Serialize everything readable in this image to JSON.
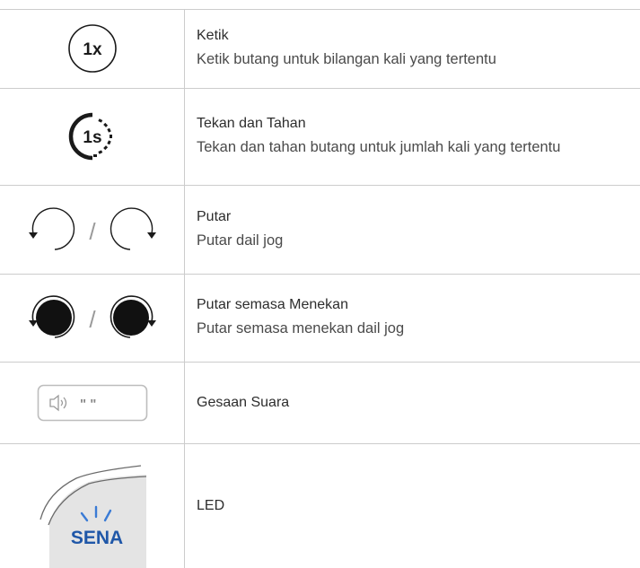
{
  "rows": [
    {
      "icon": "tap-1x-icon",
      "icon_label": "1x",
      "title": "Ketik",
      "description": "Ketik butang untuk bilangan kali yang tertentu"
    },
    {
      "icon": "press-hold-1s-icon",
      "icon_label": "1s",
      "title": "Tekan dan Tahan",
      "description": "Tekan dan tahan butang untuk jumlah kali yang tertentu"
    },
    {
      "icon": "rotate-jog-dial-icon",
      "icon_label": "/",
      "title": "Putar",
      "description": "Putar dail jog"
    },
    {
      "icon": "rotate-while-pressing-icon",
      "icon_label": "/",
      "title": "Putar semasa Menekan",
      "description": "Putar semasa menekan dail jog"
    },
    {
      "icon": "voice-prompt-icon",
      "icon_label": "\" \"",
      "title": "Gesaan Suara",
      "description": ""
    },
    {
      "icon": "led-icon",
      "icon_label": "SENA",
      "title": "LED",
      "description": ""
    }
  ],
  "colors": {
    "rule": "#cccccc",
    "icon_dark": "#1a1a1a",
    "led_blue": "#1f57a8",
    "led_glow": "#3a7bd5"
  }
}
